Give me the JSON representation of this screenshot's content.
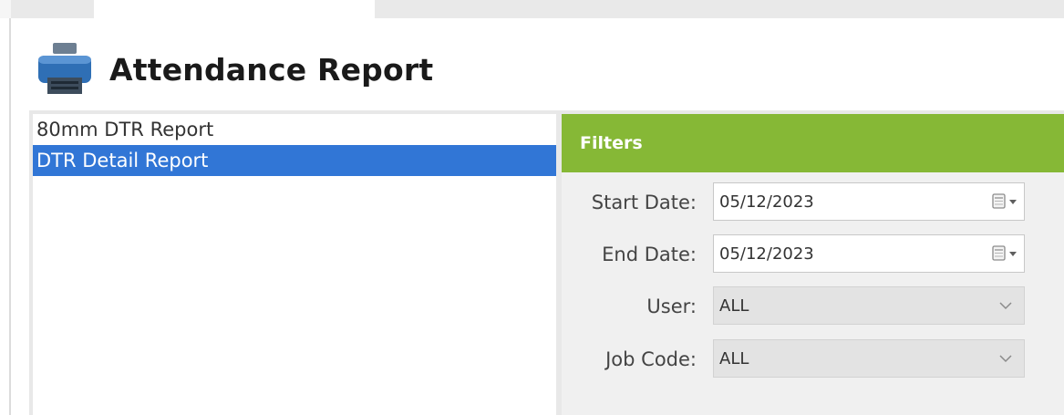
{
  "header": {
    "title": "Attendance Report",
    "icon": "printer-icon"
  },
  "reports": {
    "items": [
      {
        "label": "80mm DTR Report",
        "selected": false
      },
      {
        "label": "DTR Detail Report",
        "selected": true
      }
    ]
  },
  "filters": {
    "title": "Filters",
    "start_date": {
      "label": "Start Date:",
      "value": "05/12/2023"
    },
    "end_date": {
      "label": "End Date:",
      "value": "05/12/2023"
    },
    "user": {
      "label": "User:",
      "value": "ALL"
    },
    "job_code": {
      "label": "Job Code:",
      "value": "ALL"
    }
  },
  "colors": {
    "accent": "#86b836",
    "selection": "#3176d6"
  }
}
